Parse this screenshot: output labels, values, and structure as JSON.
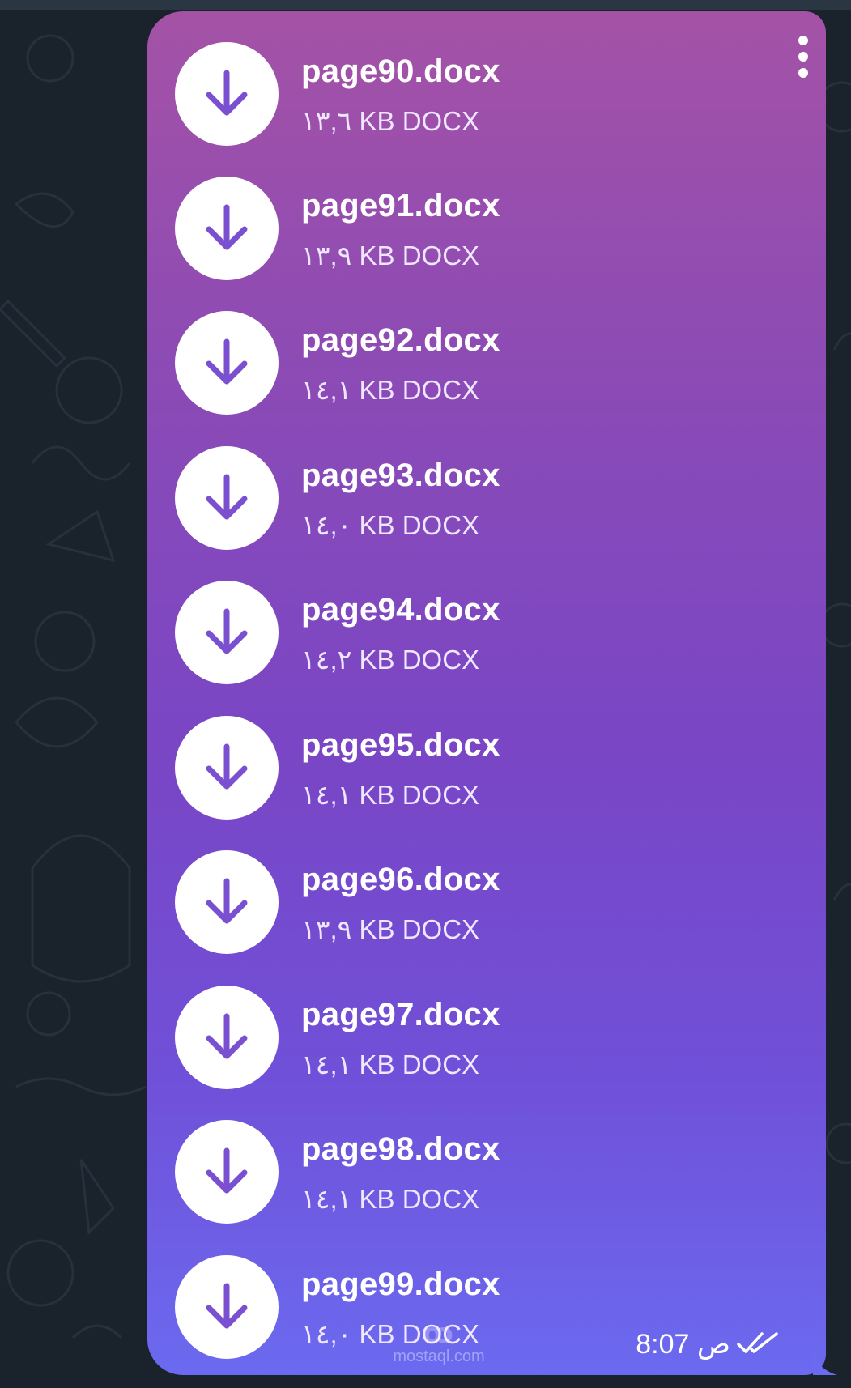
{
  "files": [
    {
      "name": "page90.docx",
      "size": "١٣,٦ KB DOCX"
    },
    {
      "name": "page91.docx",
      "size": "١٣,٩ KB DOCX"
    },
    {
      "name": "page92.docx",
      "size": "١٤,١ KB DOCX"
    },
    {
      "name": "page93.docx",
      "size": "١٤,٠ KB DOCX"
    },
    {
      "name": "page94.docx",
      "size": "١٤,٢ KB DOCX"
    },
    {
      "name": "page95.docx",
      "size": "١٤,١ KB DOCX"
    },
    {
      "name": "page96.docx",
      "size": "١٣,٩ KB DOCX"
    },
    {
      "name": "page97.docx",
      "size": "١٤,١ KB DOCX"
    },
    {
      "name": "page98.docx",
      "size": "١٤,١ KB DOCX"
    },
    {
      "name": "page99.docx",
      "size": "١٤,٠ KB DOCX"
    }
  ],
  "message": {
    "time": "8:07 ص",
    "status_icon": "double-check-icon"
  },
  "icons": {
    "download": "download-arrow-icon",
    "menu": "more-vertical-icon"
  },
  "watermark": {
    "text": "mostaql.com"
  },
  "colors": {
    "background": "#1a222c",
    "bubble_top": "#a452a6",
    "bubble_bottom": "#6b6af0",
    "accent": "#7a4fd0"
  }
}
